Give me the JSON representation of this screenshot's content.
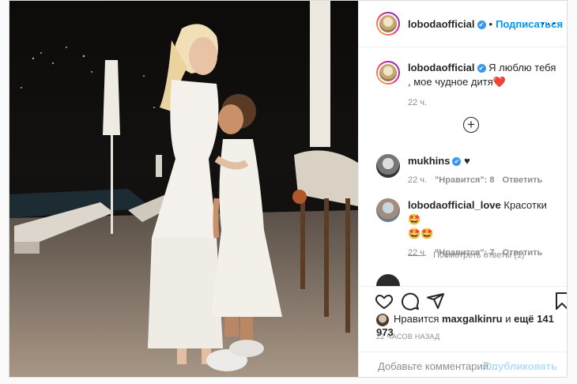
{
  "post": {
    "photo_alt": "",
    "author": {
      "username": "lobodaofficial",
      "verified": true,
      "follow_label": "Подписаться",
      "separator": "•"
    },
    "caption": {
      "username": "lobodaofficial",
      "text": "Я люблю тебя , мое чудное дитя",
      "emoji": "❤️",
      "time": "22 ч."
    },
    "load_more_icon": "plus-circle-icon",
    "comments": [
      {
        "username": "mukhins",
        "verified": true,
        "text": "♥",
        "time": "22 ч.",
        "likes": "\"Нравится\": 8",
        "reply": "Ответить"
      },
      {
        "username": "lobodaofficial_love",
        "verified": false,
        "text": "Красотки 🤩",
        "text2": "🤩🤩",
        "time": "22 ч.",
        "likes": "\"Нравится\": 7",
        "reply": "Ответить",
        "view_replies": "Посмотреть ответы (1)"
      }
    ],
    "liked_by": {
      "prefix": "Нравится",
      "user": "maxgalkinru",
      "and": "и",
      "more": "ещё 141 973"
    },
    "time_ago": "22 ЧАСОВ НАЗАД",
    "comment_input": {
      "placeholder": "Добавьте комментарий...",
      "value": ""
    },
    "publish_label": "Опубликовать",
    "colors": {
      "accent": "#0095f6",
      "publish_disabled": "#b2dffc",
      "heart": "#ed4956"
    },
    "icons": [
      "heart-icon",
      "comment-icon",
      "share-icon",
      "bookmark-icon",
      "more-options-icon",
      "verified-badge-icon",
      "heart-like-icon"
    ]
  }
}
